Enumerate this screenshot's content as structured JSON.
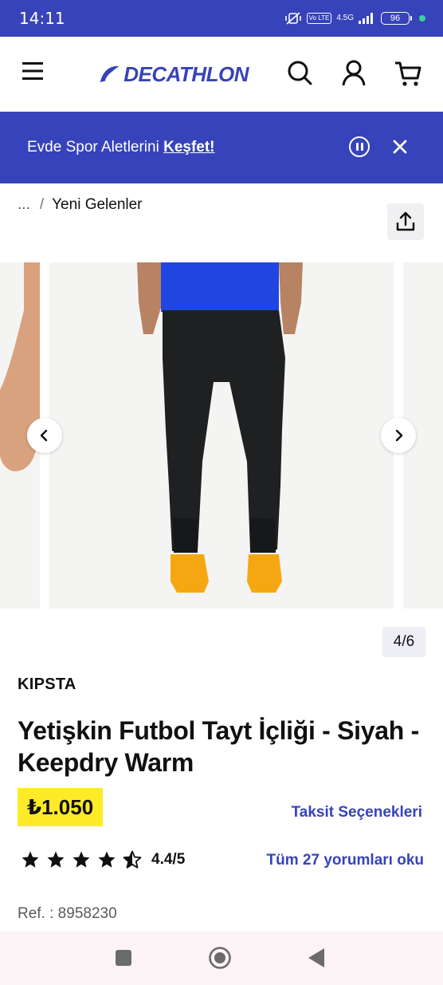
{
  "status_bar": {
    "time": "14:11",
    "volte_label": "Vo LTE",
    "network": "4.5G",
    "battery": "96"
  },
  "header": {
    "logo_text": "DECATHLON",
    "brand_color": "#3643ba"
  },
  "promo": {
    "text": "Evde Spor Aletlerini ",
    "link": "Keşfet!"
  },
  "breadcrumb": {
    "ellipsis": "...",
    "separator": "/",
    "current": "Yeni Gelenler"
  },
  "gallery": {
    "counter": "4/6"
  },
  "product": {
    "brand": "KIPSTA",
    "title": "Yetişkin Futbol Tayt İçliği - Siyah - Keepdry Warm",
    "price": "₺1.050",
    "installments_link": "Taksit Seçenekleri",
    "rating_value": "4.4/5",
    "rating": 4.4,
    "reviews_link": "Tüm 27 yorumları oku",
    "ref": "Ref. : 8958230"
  },
  "icons": {
    "menu": "menu-icon",
    "search": "search-icon",
    "account": "user-icon",
    "cart": "cart-icon",
    "share": "share-icon"
  }
}
